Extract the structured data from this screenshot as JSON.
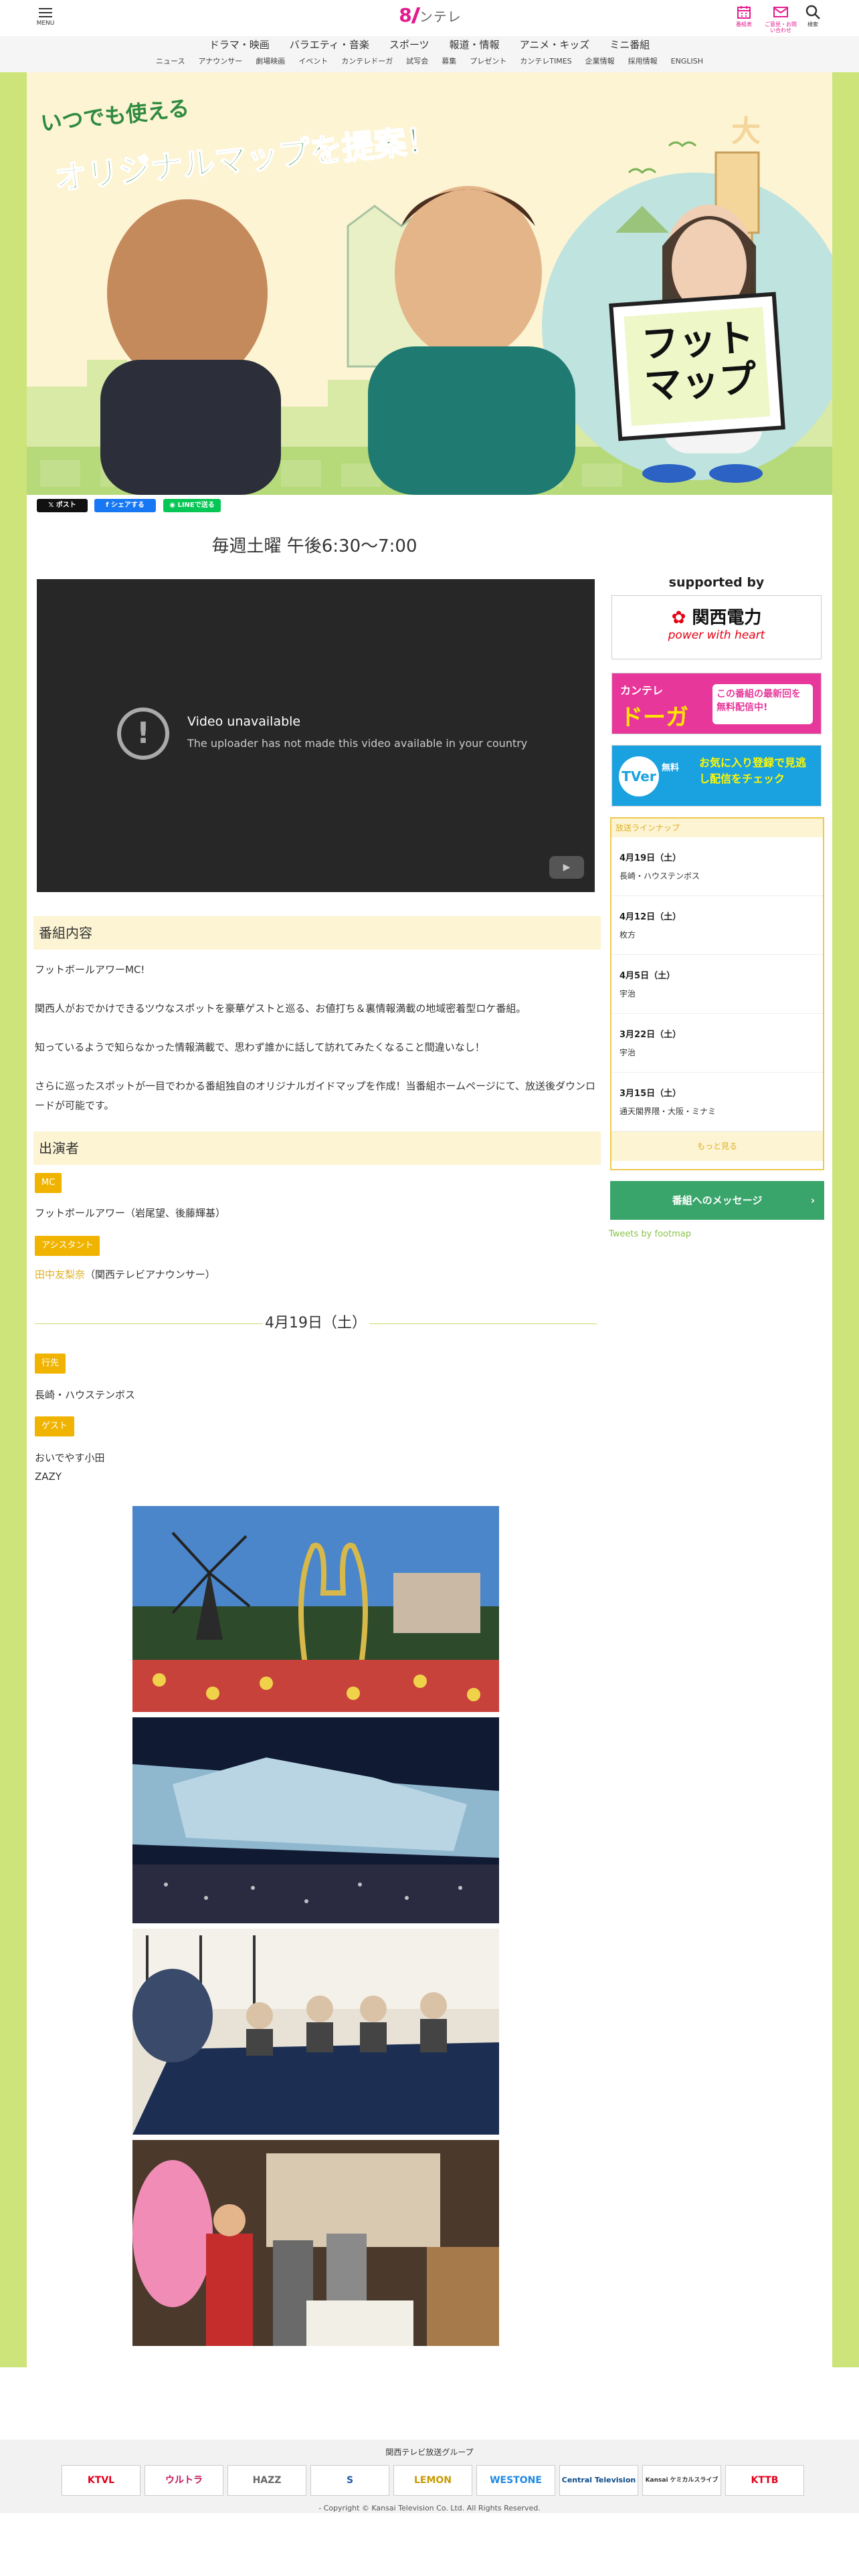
{
  "header": {
    "menu_label": "MENU",
    "logo_eight": "8",
    "logo_text": "ンテレ",
    "icons": [
      {
        "name": "calendar-icon",
        "label": "番組表"
      },
      {
        "name": "mail-icon",
        "label": "ご意見・お問い合わせ"
      },
      {
        "name": "search-icon",
        "label": "検索"
      }
    ],
    "nav_main": [
      "ドラマ・映画",
      "バラエティ・音楽",
      "スポーツ",
      "報道・情報",
      "アニメ・キッズ",
      "ミニ番組"
    ],
    "nav_sub": [
      "ニュース",
      "アナウンサー",
      "劇場映画",
      "イベント",
      "カンテレドーガ",
      "試写会",
      "募集",
      "プレゼント",
      "カンテレTIMES",
      "企業情報",
      "採用情報",
      "ENGLISH"
    ]
  },
  "hero": {
    "tagline_small": "いつでも使える",
    "tagline_big": "オリジナルマップを提案！",
    "sign_line1": "フット",
    "sign_line2": "マップ",
    "sky_char": "大"
  },
  "share": {
    "x_label": "ポスト",
    "fb_label": "シェアする",
    "line_label": "LINEで送る"
  },
  "broadcast_time": "毎週土曜 午後6:30〜7:00",
  "video": {
    "title": "Video unavailable",
    "message": "The uploader has not made this video available in your country"
  },
  "program": {
    "heading": "番組内容",
    "paragraphs": [
      "フットボールアワーMC!",
      "関西人がおでかけできるツウなスポットを豪華ゲストと巡る、お値打ち＆裏情報満載の地域密着型ロケ番組。",
      "知っているようで知らなかった情報満載で、思わず誰かに話して訪れてみたくなること間違いなし！",
      "さらに巡ったスポットが一目でわかる番組独自のオリジナルガイドマップを作成！当番組ホームページにて、放送後ダウンロードが可能です。"
    ]
  },
  "cast": {
    "heading": "出演者",
    "mc_tag": "MC",
    "mc": "フットボールアワー（岩尾望、後藤輝基）",
    "assistant_tag": "アシスタント",
    "assistant_link": "田中友梨奈",
    "assistant_suffix": "（関西テレビアナウンサー）"
  },
  "episode": {
    "date": "4月19日（土）",
    "dest_tag": "行先",
    "dest": "長崎・ハウステンボス",
    "guest_tag": "ゲスト",
    "guests": [
      "おいでやす小田",
      "ZAZY"
    ]
  },
  "sidebar": {
    "supported_by": "supported by",
    "kepco_name": "関西電力",
    "kepco_slogan": "power with heart",
    "doga_brand": "カンテレ",
    "doga_name": "ドーガ",
    "doga_text": "この番組の最新回を無料配信中!",
    "tver_brand": "TVer",
    "tver_free": "無料",
    "tver_text": "お気に入り登録で見逃し配信をチェック",
    "lineup_heading": "放送ラインナップ",
    "lineup": [
      {
        "date": "4月19日（土）",
        "place": "長崎・ハウステンボス"
      },
      {
        "date": "4月12日（土）",
        "place": "枚方"
      },
      {
        "date": "4月5日（土）",
        "place": "宇治"
      },
      {
        "date": "3月22日（土）",
        "place": "宇治"
      },
      {
        "date": "3月15日（土）",
        "place": "通天閣界隈・大阪・ミナミ"
      }
    ],
    "more": "もっと見る",
    "message_button": "番組へのメッセージ",
    "tweets": "Tweets by footmap"
  },
  "footer": {
    "group": "関西テレビ放送グループ",
    "logos": [
      "KTVL",
      "ウルトラ",
      "HAZZ",
      "S",
      "LEMON",
      "WESTONE",
      "Central Television",
      "Kansai ケミカルスライブ",
      "KTTB"
    ],
    "copyright": "- Copyright © Kansai Television Co. Ltd. All Rights Reserved."
  },
  "colors": {
    "accent": "#e31b8e",
    "band": "#cde47b",
    "tag": "#f0b400",
    "cream": "#fdf4d4",
    "message": "#3aa56b"
  }
}
